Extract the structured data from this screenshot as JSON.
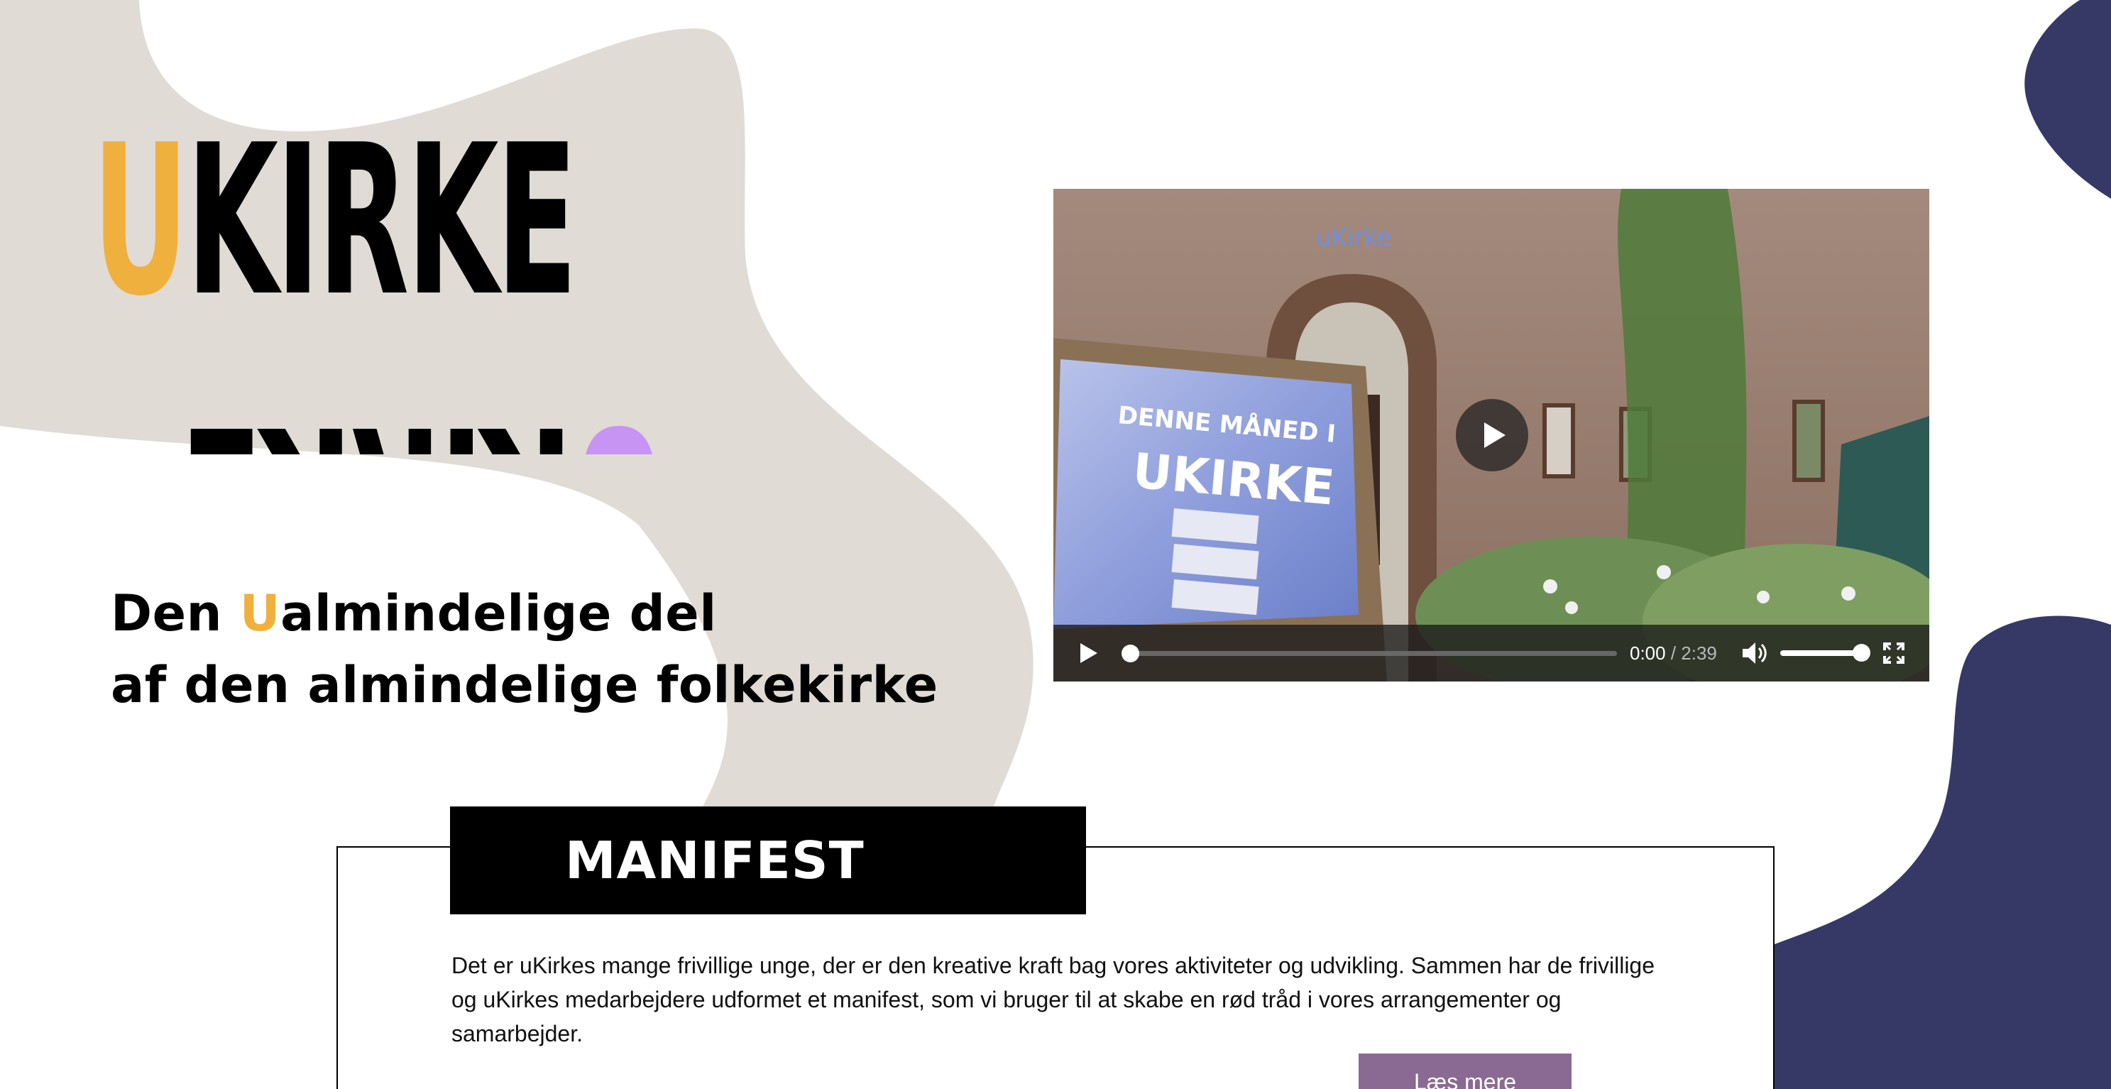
{
  "logo": {
    "top_u": "U",
    "top_rest": "KIRKE",
    "bottom_u": "U",
    "bottom_rest": "KIRKE",
    "colors": {
      "top_u": "#f0b03d",
      "bottom_u": "#c794f4",
      "letters": "#000000"
    }
  },
  "tagline": {
    "line1_prefix": "Den ",
    "line1_accent": "U",
    "line1_suffix": "almindelige del",
    "line2": "af den almindelige folkekirke"
  },
  "video": {
    "current_time": "0:00",
    "separator": " / ",
    "duration": "2:39",
    "progress_fraction": 0.0,
    "volume_fraction": 1.0,
    "icons": {
      "play": "play-icon",
      "volume": "volume-icon",
      "fullscreen": "fullscreen-icon"
    }
  },
  "manifest": {
    "title": "MANIFEST",
    "body": "Det er uKirkes mange frivillige unge, der er den kreative kraft bag vores aktiviteter og udvikling. Sammen har de frivillige og uKirkes medarbejdere udformet et manifest, som vi bruger til at skabe en rød tråd i vores arrangementer og samarbejder.",
    "button_label": "Læs mere"
  },
  "colors": {
    "blob_beige": "#e0dbd4",
    "blob_navy": "#363866",
    "accent_yellow": "#f0b03d",
    "accent_purple": "#c794f4",
    "button_purple": "#8a6a92"
  }
}
